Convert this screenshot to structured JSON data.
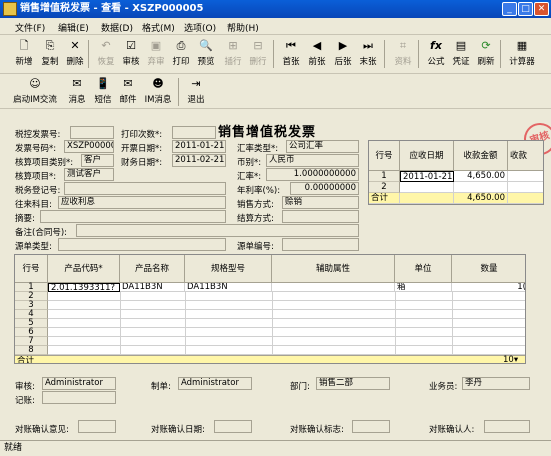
{
  "window": {
    "title": "销售增值税发票 - 查看 - XSZP000005"
  },
  "menu": [
    "文件(F)",
    "编辑(E)",
    "数据(D)",
    "格式(M)",
    "选项(O)",
    "帮助(H)"
  ],
  "toolbar1": [
    {
      "label": "新增",
      "icon": "new-doc-icon",
      "enabled": true
    },
    {
      "label": "复制",
      "icon": "copy-icon",
      "enabled": true
    },
    {
      "label": "删除",
      "icon": "delete-icon",
      "enabled": true
    },
    {
      "label": "恢复",
      "icon": "restore-icon",
      "enabled": false
    },
    {
      "label": "审核",
      "icon": "audit-icon",
      "enabled": true
    },
    {
      "label": "弃审",
      "icon": "unaudit-icon",
      "enabled": false
    },
    {
      "label": "打印",
      "icon": "print-icon",
      "enabled": true
    },
    {
      "label": "预览",
      "icon": "preview-icon",
      "enabled": true
    },
    {
      "label": "插行",
      "icon": "insert-row-icon",
      "enabled": false
    },
    {
      "label": "删行",
      "icon": "delete-row-icon",
      "enabled": false
    },
    {
      "label": "首张",
      "icon": "first-icon",
      "enabled": true
    },
    {
      "label": "前张",
      "icon": "prev-icon",
      "enabled": true
    },
    {
      "label": "后张",
      "icon": "next-icon",
      "enabled": true
    },
    {
      "label": "末张",
      "icon": "last-icon",
      "enabled": true
    },
    {
      "label": "资料",
      "icon": "info-icon",
      "enabled": false
    },
    {
      "label": "公式",
      "icon": "formula-icon",
      "enabled": true
    },
    {
      "label": "凭证",
      "icon": "voucher-icon",
      "enabled": true
    },
    {
      "label": "刷新",
      "icon": "refresh-icon",
      "enabled": true
    },
    {
      "label": "计算器",
      "icon": "calculator-icon",
      "enabled": true
    }
  ],
  "toolbar2": [
    {
      "label": "启动IM交流",
      "icon": "im-start-icon"
    },
    {
      "label": "消息",
      "icon": "message-icon"
    },
    {
      "label": "短信",
      "icon": "sms-icon"
    },
    {
      "label": "邮件",
      "icon": "mail-icon"
    },
    {
      "label": "IM消息",
      "icon": "im-message-icon"
    },
    {
      "label": "退出",
      "icon": "exit-icon"
    }
  ],
  "form": {
    "title": "销售增值税发票",
    "stamp": "审核",
    "tax_invoice_no_label": "税控发票号:",
    "tax_invoice_no": "",
    "print_count_label": "打印次数*:",
    "print_count": "",
    "invoice_no_label": "发票号码*:",
    "invoice_no": "XSZP000005",
    "invoice_date_label": "开票日期*:",
    "invoice_date": "2011-01-21",
    "rate_type_label": "汇率类型*:",
    "rate_type": "公司汇率",
    "acct_cat_label": "核算项目类别*:",
    "acct_cat": "客户",
    "fin_date_label": "财务日期*:",
    "fin_date": "2011-02-21",
    "currency_label": "币别*:",
    "currency": "人民币",
    "acct_item_label": "核算项目*:",
    "acct_item": "测试客户",
    "rate_label": "汇率*:",
    "rate": "1.0000000000",
    "tax_reg_label": "税务登记号:",
    "tax_reg": "",
    "annual_rate_label": "年利率(%):",
    "annual_rate": "0.00000000",
    "subject_label": "往来科目:",
    "subject": "应收利息",
    "sale_method_label": "销售方式:",
    "sale_method": "赊销",
    "summary_label": "摘要:",
    "summary": "",
    "settle_label": "结算方式:",
    "settle": "",
    "remark_label": "备注(合同号):",
    "remark": "",
    "src_type_label": "源单类型:",
    "src_type": "",
    "src_no_label": "源单编号:",
    "src_no": ""
  },
  "recv_grid": {
    "headers": [
      "行号",
      "应收日期",
      "收款金额",
      "收款"
    ],
    "rows": [
      {
        "no": "1",
        "date": "2011-01-21",
        "amount": "4,650.00"
      },
      {
        "no": "2",
        "date": "",
        "amount": ""
      }
    ],
    "total_label": "合计",
    "total_amount": "4,650.00"
  },
  "detail_grid": {
    "headers": [
      "行号",
      "产品代码*",
      "产品名称",
      "规格型号",
      "辅助属性",
      "单位",
      "数量"
    ],
    "rows": [
      {
        "no": "1",
        "code": "2.01.1393311?",
        "name": "DA11B3N",
        "spec": "DA11B3N",
        "attr": "",
        "unit": "箱",
        "qty": "1("
      },
      {
        "no": "2"
      },
      {
        "no": "3"
      },
      {
        "no": "4"
      },
      {
        "no": "5"
      },
      {
        "no": "6"
      },
      {
        "no": "7"
      },
      {
        "no": "8"
      }
    ],
    "total_label": "合计",
    "total_qty": "10▾"
  },
  "footer": {
    "auditor_label": "审核:",
    "auditor": "Administrator",
    "maker_label": "制单:",
    "maker": "Administrator",
    "dept_label": "部门:",
    "dept": "销售二部",
    "salesman_label": "业务员:",
    "salesman": "李丹",
    "booker_label": "记账:",
    "booker": "",
    "confirm_opinion_label": "对账确认意见:",
    "confirm_date_label": "对账确认日期:",
    "confirm_flag_label": "对账确认标志:",
    "confirm_person_label": "对账确认人:"
  },
  "status": "就绪"
}
